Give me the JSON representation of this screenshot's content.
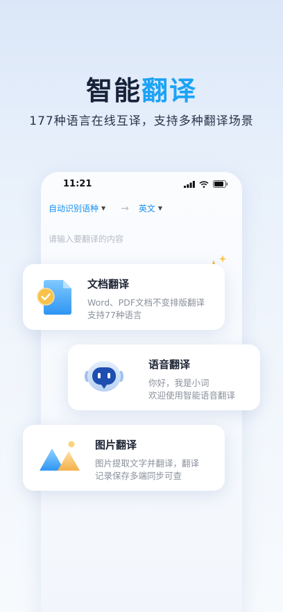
{
  "hero": {
    "title_main": "智能",
    "title_accent": "翻译",
    "subtitle": "177种语言在线互译，支持多种翻译场景"
  },
  "phone": {
    "status_time": "11:21",
    "source_lang": "自动识别语种",
    "target_lang": "英文",
    "input_placeholder": "请输入要翻译的内容"
  },
  "cards": [
    {
      "title": "文档翻译",
      "lines": [
        "Word、PDF文档不变排版翻译",
        "支持77种语言"
      ],
      "icon": "document-icon"
    },
    {
      "title": "语音翻译",
      "lines": [
        "你好，我是小词",
        "欢迎使用智能语音翻译"
      ],
      "icon": "robot-icon"
    },
    {
      "title": "图片翻译",
      "lines": [
        "图片提取文字并翻译，翻译",
        "记录保存多端同步可查"
      ],
      "icon": "mountain-image-icon"
    }
  ],
  "colors": {
    "accent": "#1ba3f6",
    "title_dark": "#18233a",
    "lang_blue": "#1a8ff0",
    "spark": "#f6b62a"
  }
}
